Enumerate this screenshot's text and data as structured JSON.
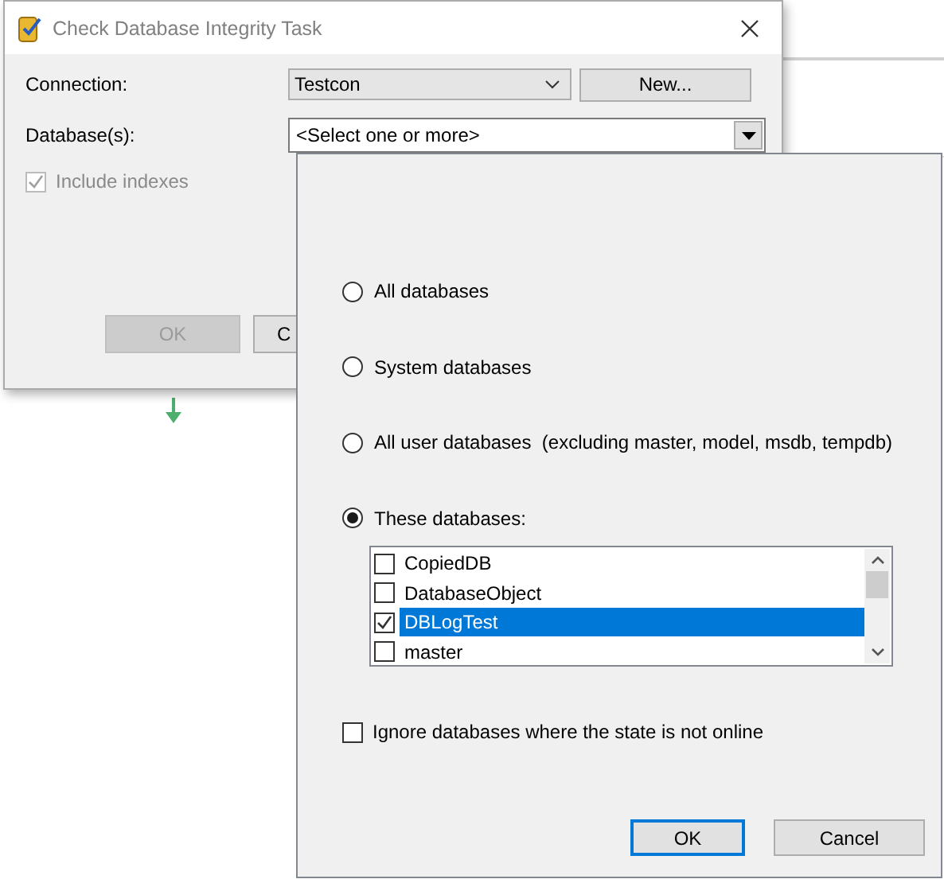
{
  "dialog": {
    "title": "Check Database Integrity Task",
    "connection": {
      "label": "Connection:",
      "value": "Testcon",
      "new_button": "New..."
    },
    "databases": {
      "label": "Database(s):",
      "value": "<Select one or more>"
    },
    "include_indexes": {
      "label": "Include indexes",
      "checked": true,
      "disabled": true
    },
    "buttons": [
      {
        "label": "OK",
        "disabled": true
      },
      {
        "label": "C",
        "disabled": false
      }
    ]
  },
  "popup": {
    "options": [
      {
        "label": "All databases",
        "selected": false
      },
      {
        "label": "System databases",
        "selected": false
      },
      {
        "label": "All user databases  (excluding master, model, msdb, tempdb)",
        "selected": false
      },
      {
        "label": "These databases:",
        "selected": true
      }
    ],
    "databases": [
      {
        "name": "CopiedDB",
        "checked": false,
        "selected": false
      },
      {
        "name": "DatabaseObject",
        "checked": false,
        "selected": false
      },
      {
        "name": "DBLogTest",
        "checked": true,
        "selected": true
      },
      {
        "name": "master",
        "checked": false,
        "selected": false
      }
    ],
    "ignore_offline": {
      "label": "Ignore databases where the state is not online",
      "checked": false
    },
    "buttons": [
      {
        "label": "OK",
        "default": true
      },
      {
        "label": "Cancel",
        "default": false
      }
    ]
  }
}
